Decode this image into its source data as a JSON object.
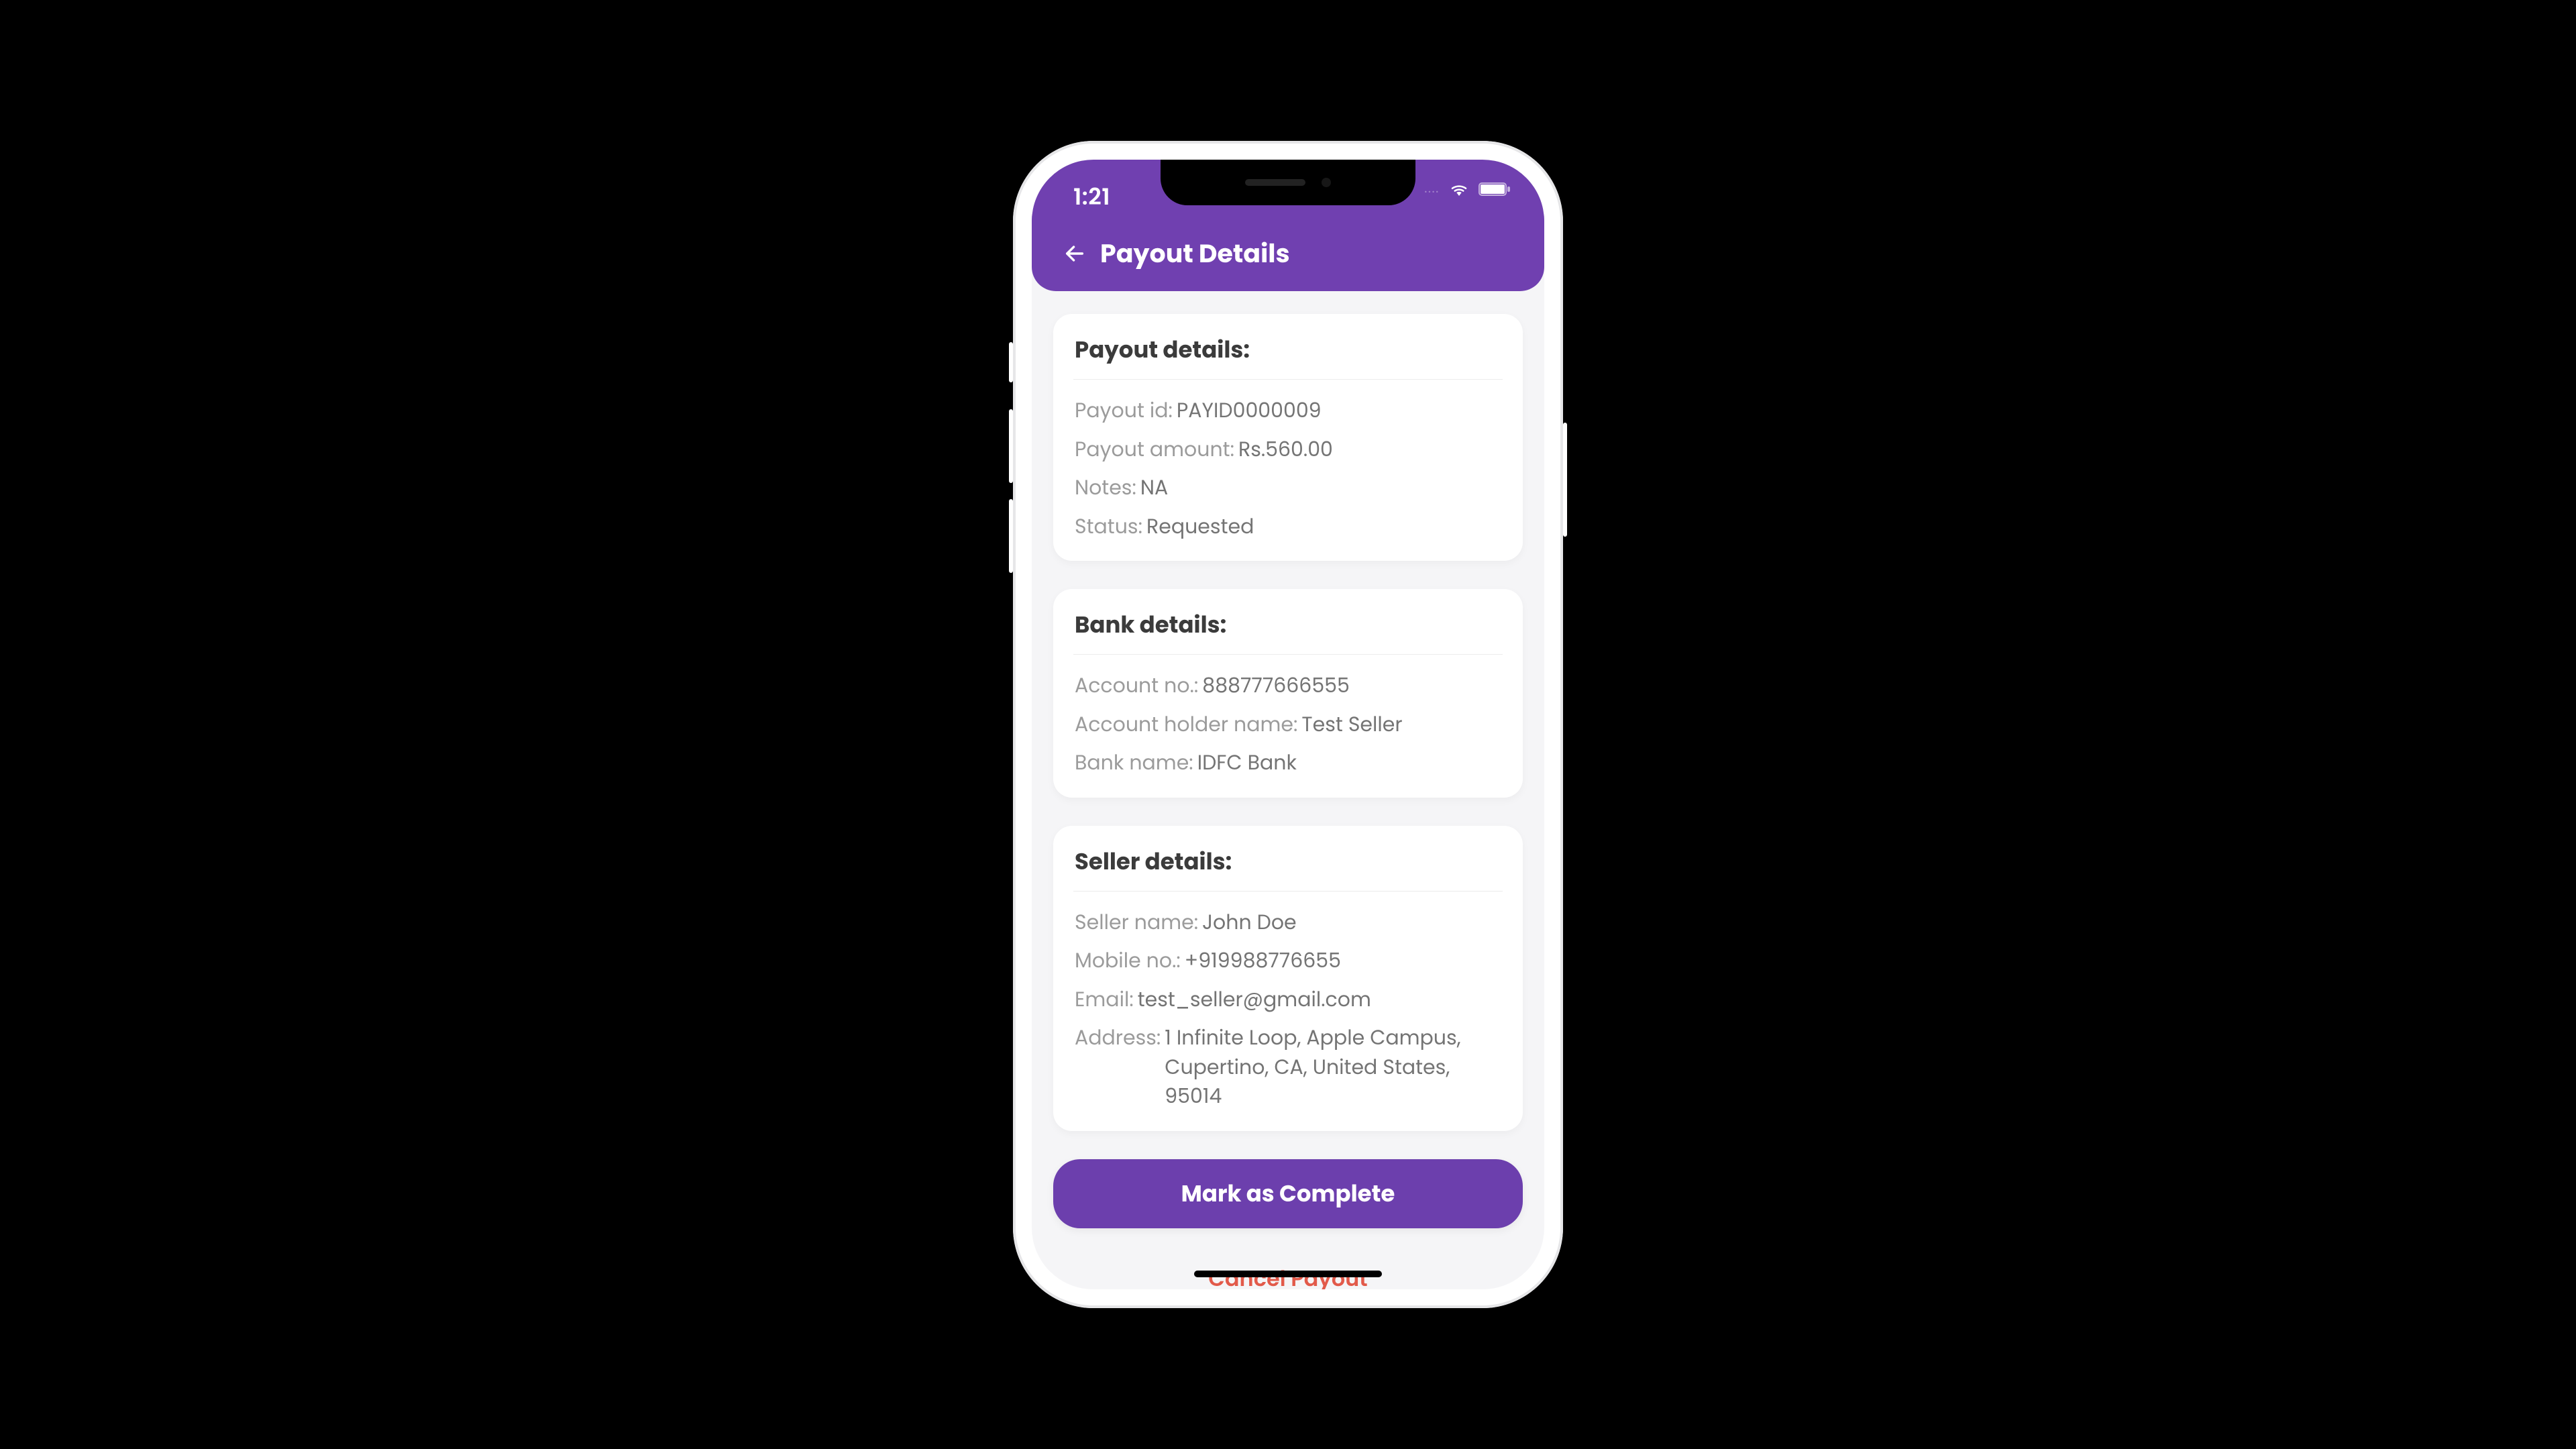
{
  "status_bar": {
    "time": "1:21"
  },
  "header": {
    "title": "Payout Details"
  },
  "sections": {
    "payout": {
      "title": "Payout details:",
      "payout_id_label": "Payout id: ",
      "payout_id_value": "PAYID0000009",
      "amount_label": "Payout amount: ",
      "amount_value": "Rs.560.00",
      "notes_label": "Notes: ",
      "notes_value": "NA",
      "status_label": "Status: ",
      "status_value": "Requested"
    },
    "bank": {
      "title": "Bank details:",
      "account_no_label": "Account no.: ",
      "account_no_value": "888777666555",
      "holder_label": "Account holder name: ",
      "holder_value": "Test Seller",
      "bank_name_label": "Bank name: ",
      "bank_name_value": "IDFC Bank"
    },
    "seller": {
      "title": "Seller details:",
      "name_label": "Seller name: ",
      "name_value": "John Doe",
      "mobile_label": "Mobile no.: ",
      "mobile_value": "+919988776655",
      "email_label": "Email: ",
      "email_value": "test_seller@gmail.com",
      "address_label": "Address: ",
      "address_value": "1 Infinite Loop, Apple Campus, Cupertino, CA, United States, 95014"
    }
  },
  "actions": {
    "primary": "Mark as Complete",
    "cancel": "Cancel Payout"
  },
  "colors": {
    "brand": "#7040b0",
    "danger": "#e25a4a"
  }
}
